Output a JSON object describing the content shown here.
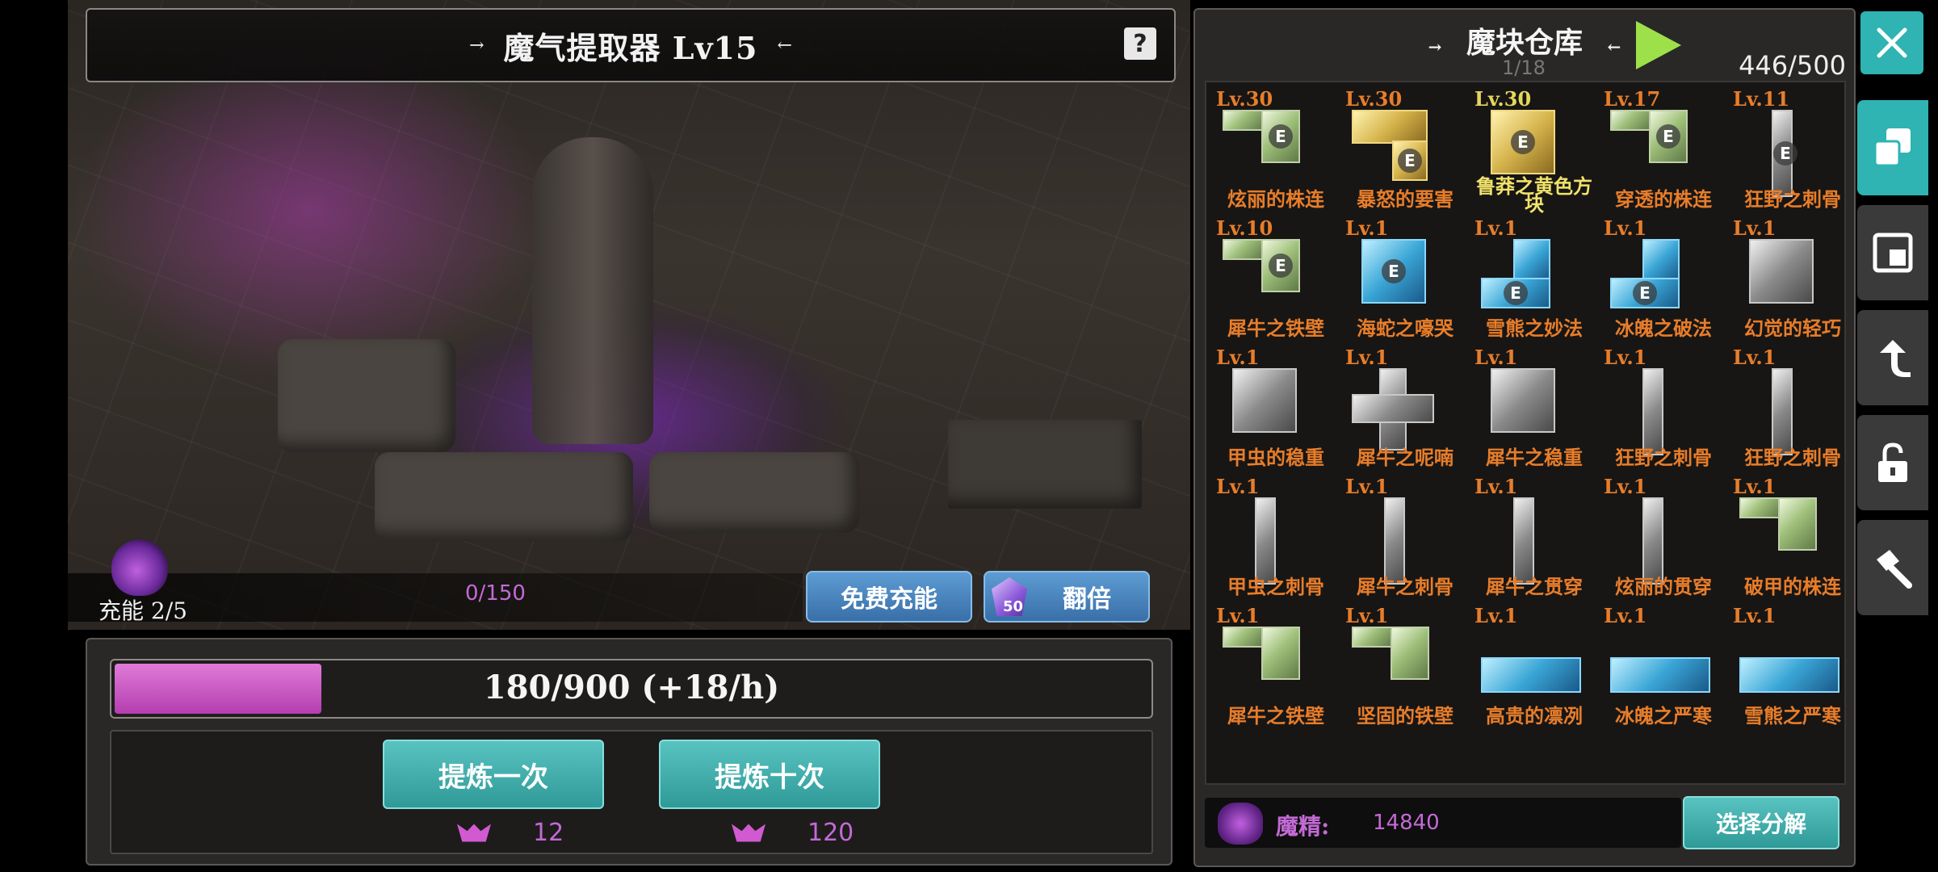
{
  "header": {
    "title": "魔气提取器 Lv15",
    "help_icon": "help-icon"
  },
  "charge": {
    "label": "充能 2/5",
    "count": "0/150"
  },
  "buttons": {
    "free_charge": "免费充能",
    "double": "翻倍",
    "double_gem_count": "50",
    "refine_once": "提炼一次",
    "refine_ten": "提炼十次"
  },
  "progress": {
    "text": "180/900 (+18/h)",
    "fraction": 0.2,
    "color": "#c94fc5"
  },
  "costs": {
    "once": "12",
    "ten": "120"
  },
  "inventory": {
    "title": "魔块仓库",
    "page": "1/18",
    "capacity": "446/500",
    "items": [
      {
        "level": "Lv.30",
        "name": "炫丽的株连",
        "color": "green",
        "shape": "L",
        "gold": false
      },
      {
        "level": "Lv.30",
        "name": "暴怒的要害",
        "color": "gold",
        "shape": "L2",
        "gold": false
      },
      {
        "level": "Lv.30",
        "name": "鲁莽之黄色方块",
        "color": "gold",
        "shape": "sq",
        "gold": true
      },
      {
        "level": "Lv.17",
        "name": "穿透的株连",
        "color": "green",
        "shape": "L",
        "gold": false
      },
      {
        "level": "Lv.11",
        "name": "狂野之刺骨",
        "color": "gray",
        "shape": "I",
        "gold": false
      },
      {
        "level": "Lv.10",
        "name": "犀牛之铁壁",
        "color": "green",
        "shape": "L",
        "gold": false
      },
      {
        "level": "Lv.1",
        "name": "海蛇之嚎哭",
        "color": "blue",
        "shape": "sq",
        "gold": false
      },
      {
        "level": "Lv.1",
        "name": "雪熊之妙法",
        "color": "blue",
        "shape": "J",
        "gold": false
      },
      {
        "level": "Lv.1",
        "name": "冰魄之破法",
        "color": "blue",
        "shape": "J",
        "gold": false
      },
      {
        "level": "Lv.1",
        "name": "幻觉的轻巧",
        "color": "gray",
        "shape": "sq",
        "gold": false
      },
      {
        "level": "Lv.1",
        "name": "甲虫的稳重",
        "color": "gray",
        "shape": "sq",
        "gold": false
      },
      {
        "level": "Lv.1",
        "name": "犀牛之呢喃",
        "color": "gray",
        "shape": "plus",
        "gold": false
      },
      {
        "level": "Lv.1",
        "name": "犀牛之稳重",
        "color": "gray",
        "shape": "sq",
        "gold": false
      },
      {
        "level": "Lv.1",
        "name": "狂野之刺骨",
        "color": "gray",
        "shape": "I",
        "gold": false
      },
      {
        "level": "Lv.1",
        "name": "狂野之刺骨",
        "color": "gray",
        "shape": "I",
        "gold": false
      },
      {
        "level": "Lv.1",
        "name": "甲虫之刺骨",
        "color": "gray",
        "shape": "I",
        "gold": false
      },
      {
        "level": "Lv.1",
        "name": "犀牛之刺骨",
        "color": "gray",
        "shape": "I",
        "gold": false
      },
      {
        "level": "Lv.1",
        "name": "犀牛之贯穿",
        "color": "gray",
        "shape": "I",
        "gold": false
      },
      {
        "level": "Lv.1",
        "name": "炫丽的贯穿",
        "color": "gray",
        "shape": "I",
        "gold": false
      },
      {
        "level": "Lv.1",
        "name": "破甲的株连",
        "color": "green",
        "shape": "L",
        "gold": false
      },
      {
        "level": "Lv.1",
        "name": "犀牛之铁壁",
        "color": "green",
        "shape": "L",
        "gold": false
      },
      {
        "level": "Lv.1",
        "name": "坚固的铁壁",
        "color": "green",
        "shape": "L",
        "gold": false
      },
      {
        "level": "Lv.1",
        "name": "高贵的凛冽",
        "color": "blue",
        "shape": "H",
        "gold": false
      },
      {
        "level": "Lv.1",
        "name": "冰魄之严寒",
        "color": "blue",
        "shape": "H",
        "gold": false
      },
      {
        "level": "Lv.1",
        "name": "雪熊之严寒",
        "color": "blue",
        "shape": "H",
        "gold": false
      }
    ]
  },
  "essence": {
    "label": "魔精:",
    "value": "14840"
  },
  "decompose": "选择分解",
  "sidebar": [
    "close-icon",
    "copy-blocks-icon",
    "square-block-icon",
    "rotate-arrow-icon",
    "unlock-icon",
    "hammer-icon"
  ],
  "colors": {
    "accent_teal": "#2fb3b3",
    "level_orange": "#e87d2a",
    "magenta": "#c36ad6"
  }
}
